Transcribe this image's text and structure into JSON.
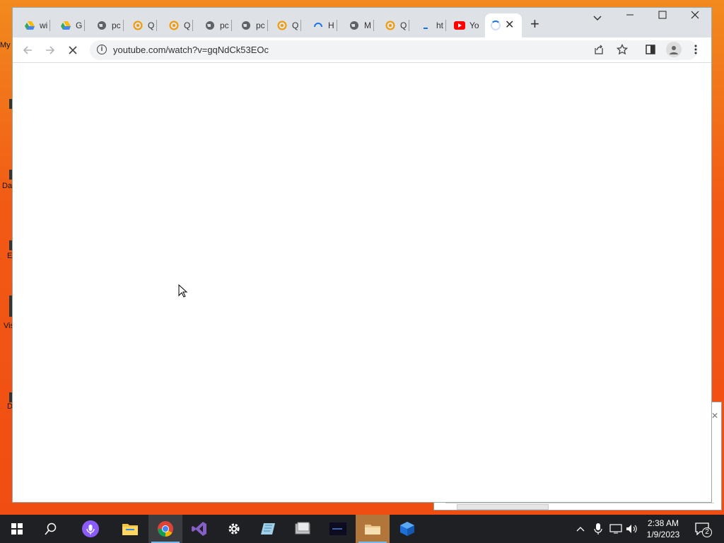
{
  "desktop": {
    "labels": [
      "My",
      "Da",
      "E",
      "Vis",
      "D"
    ]
  },
  "browser": {
    "tabs": [
      {
        "label": "wi",
        "icon": "google-drive-icon"
      },
      {
        "label": "G",
        "icon": "google-drive-icon"
      },
      {
        "label": "pc",
        "icon": "globe-icon"
      },
      {
        "label": "Q",
        "icon": "q-icon"
      },
      {
        "label": "Q",
        "icon": "q-icon"
      },
      {
        "label": "pc",
        "icon": "globe-icon"
      },
      {
        "label": "pc",
        "icon": "globe-icon"
      },
      {
        "label": "Q",
        "icon": "q-icon"
      },
      {
        "label": "H",
        "icon": "loading-icon"
      },
      {
        "label": "M",
        "icon": "globe-icon"
      },
      {
        "label": "Q",
        "icon": "q-icon"
      },
      {
        "label": "ht",
        "icon": "blank-icon"
      },
      {
        "label": "Yo",
        "icon": "youtube-icon"
      }
    ],
    "active_tab_close": "✕",
    "new_tab": "+",
    "url": "youtube.com/watch?v=gqNdCk53EOc",
    "info_glyph": "i"
  },
  "background_window": {
    "close": "✕"
  },
  "taskbar": {
    "apps": [
      "start-icon",
      "search-icon",
      "cortana-icon",
      "file-explorer-icon",
      "chrome-icon",
      "visual-studio-icon",
      "settings-icon",
      "app-icon",
      "app-icon-2",
      "terminal-icon",
      "folder-icon",
      "virtualbox-icon"
    ],
    "time": "2:38 AM",
    "date": "1/9/2023",
    "notification_count": "2"
  }
}
